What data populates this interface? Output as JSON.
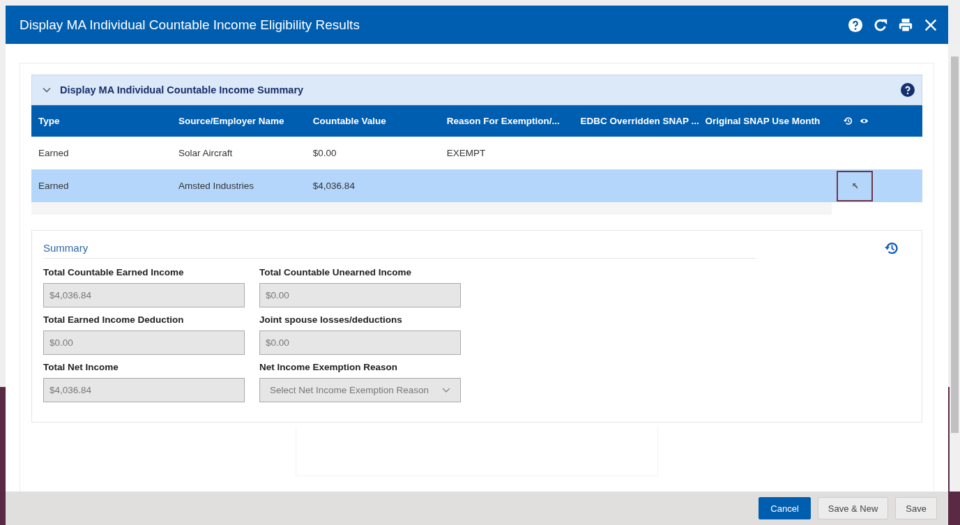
{
  "window": {
    "title": "Display MA Individual Countable Income Eligibility Results"
  },
  "section": {
    "title": "Display MA Individual Countable Income Summary",
    "expanded": true
  },
  "table": {
    "columns": [
      "Type",
      "Source/Employer Name",
      "Countable Value",
      "Reason For Exemption/...",
      "EDBC Overridden SNAP ...",
      "Original SNAP Use Month"
    ],
    "rows": [
      {
        "cells": [
          "Earned",
          "Solar Aircraft",
          "$0.00",
          "EXEMPT",
          "",
          ""
        ],
        "selected": false,
        "row_button": false
      },
      {
        "cells": [
          "Earned",
          "Amsted Industries",
          "$4,036.84",
          "",
          "",
          ""
        ],
        "selected": true,
        "row_button": true
      }
    ]
  },
  "summary": {
    "title": "Summary",
    "fields": [
      {
        "kind": "text",
        "label": "Total Countable Earned Income",
        "value": "$4,036.84",
        "disabled": true
      },
      {
        "kind": "text",
        "label": "Total Countable Unearned Income",
        "value": "$0.00",
        "disabled": true
      },
      {
        "kind": "text",
        "label": "Total Earned Income Deduction",
        "value": "$0.00",
        "disabled": true
      },
      {
        "kind": "text",
        "label": "Joint spouse losses/deductions",
        "value": "$0.00",
        "disabled": true
      },
      {
        "kind": "text",
        "label": "Total Net Income",
        "value": "$4,036.84",
        "disabled": true
      },
      {
        "kind": "select",
        "label": "Net Income Exemption Reason",
        "placeholder": "Select Net Income Exemption Reason",
        "disabled": true
      }
    ]
  },
  "buttons": [
    {
      "label": "Cancel",
      "primary": true
    },
    {
      "label": "Save & New",
      "primary": false
    },
    {
      "label": "Save",
      "primary": false
    }
  ]
}
